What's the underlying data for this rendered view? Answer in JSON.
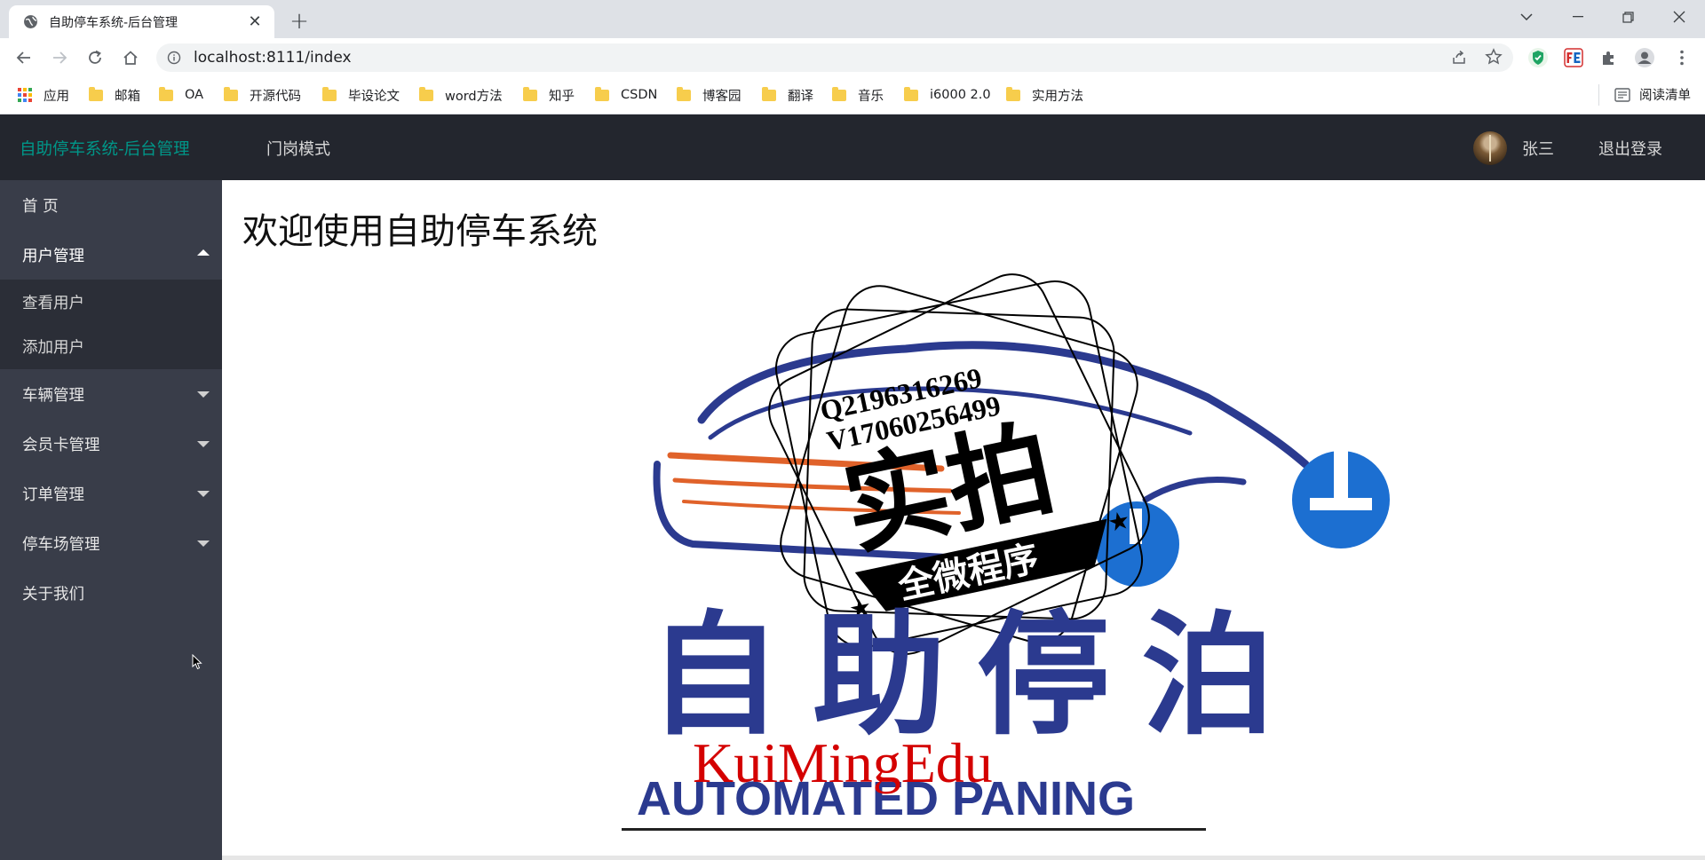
{
  "browser": {
    "tab_title": "自助停车系统-后台管理",
    "url": "localhost:8111/index",
    "bookmarks": [
      {
        "label": "应用",
        "type": "apps"
      },
      {
        "label": "邮箱",
        "type": "folder"
      },
      {
        "label": "OA",
        "type": "folder"
      },
      {
        "label": "开源代码",
        "type": "folder"
      },
      {
        "label": "毕设论文",
        "type": "folder"
      },
      {
        "label": "word方法",
        "type": "folder"
      },
      {
        "label": "知乎",
        "type": "folder"
      },
      {
        "label": "CSDN",
        "type": "folder"
      },
      {
        "label": "博客园",
        "type": "folder"
      },
      {
        "label": "翻译",
        "type": "folder"
      },
      {
        "label": "音乐",
        "type": "folder"
      },
      {
        "label": "i6000 2.0",
        "type": "folder"
      },
      {
        "label": "实用方法",
        "type": "folder"
      }
    ],
    "reading_list": "阅读清单"
  },
  "header": {
    "brand": "自助停车系统-后台管理",
    "gate_mode": "门岗模式",
    "username": "张三",
    "logout": "退出登录"
  },
  "sidebar": {
    "items": [
      {
        "label": "首 页",
        "expandable": false
      },
      {
        "label": "用户管理",
        "expandable": true,
        "expanded": true,
        "children": [
          {
            "label": "查看用户"
          },
          {
            "label": "添加用户"
          }
        ]
      },
      {
        "label": "车辆管理",
        "expandable": true,
        "expanded": false
      },
      {
        "label": "会员卡管理",
        "expandable": true,
        "expanded": false
      },
      {
        "label": "订单管理",
        "expandable": true,
        "expanded": false
      },
      {
        "label": "停车场管理",
        "expandable": true,
        "expanded": false
      },
      {
        "label": "关于我们",
        "expandable": false
      }
    ]
  },
  "main": {
    "welcome": "欢迎使用自助停车系统"
  },
  "hero_image": {
    "logo_cn": "自助停泊",
    "logo_en": "AUTOMATED PANING",
    "stamp_big": "实拍",
    "stamp_ribbon": "全微程序",
    "stamp_qq": "Q2196316269",
    "stamp_vx": "V17060256499",
    "watermark": "KuiMingEdu"
  },
  "colors": {
    "brand_green": "#009688",
    "header_bg": "#23262e",
    "sidebar_bg": "#393d49",
    "subnav_bg": "#2b2e37",
    "logo_blue": "#2b3a8f",
    "logo_orange": "#e0622a",
    "watermark_red": "#d40000"
  }
}
